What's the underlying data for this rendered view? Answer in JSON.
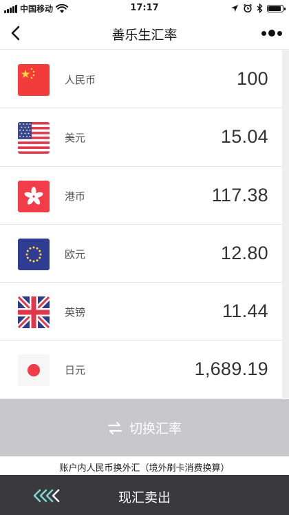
{
  "status_bar": {
    "carrier": "中国移动",
    "time": "17:17"
  },
  "nav": {
    "title": "善乐生汇率",
    "back_icon": "chevron-left-icon",
    "more_icon": "more-dots-icon"
  },
  "rates": [
    {
      "name": "人民币",
      "amount": "100",
      "flag": "china-flag-icon"
    },
    {
      "name": "美元",
      "amount": "15.04",
      "flag": "usa-flag-icon"
    },
    {
      "name": "港币",
      "amount": "117.38",
      "flag": "hong-kong-flag-icon"
    },
    {
      "name": "欧元",
      "amount": "12.80",
      "flag": "eu-flag-icon"
    },
    {
      "name": "英镑",
      "amount": "11.44",
      "flag": "uk-flag-icon"
    },
    {
      "name": "日元",
      "amount": "1,689.19",
      "flag": "japan-flag-icon"
    }
  ],
  "switch_button": {
    "label": "切换汇率",
    "icon": "swap-arrows-icon"
  },
  "footnote": "账户内人民币换外汇（境外刷卡消费换算）",
  "bottom_bar": {
    "label": "现汇卖出",
    "icon": "chevrons-left-icon"
  },
  "colors": {
    "switch_bg": "#c8c8cb",
    "bottom_bg": "#3a3a3c",
    "chevron": "#7fd6d0"
  }
}
